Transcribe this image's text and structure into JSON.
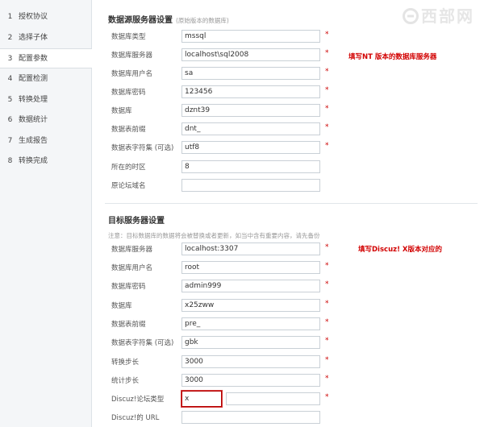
{
  "sidebar": {
    "steps": [
      {
        "num": "1",
        "label": "授权协议"
      },
      {
        "num": "2",
        "label": "选择子体"
      },
      {
        "num": "3",
        "label": "配置参数"
      },
      {
        "num": "4",
        "label": "配置检测"
      },
      {
        "num": "5",
        "label": "转换处理"
      },
      {
        "num": "6",
        "label": "数据统计"
      },
      {
        "num": "7",
        "label": "生成报告"
      },
      {
        "num": "8",
        "label": "转换完成"
      }
    ]
  },
  "logo": {
    "text": "西部网"
  },
  "source_section": {
    "title": "数据源服务器设置",
    "subtitle": "(原始版本的数据库)",
    "annotation": "填写NT 版本的数据库服务器",
    "fields": [
      {
        "label": "数据库类型",
        "value": "mssql",
        "required": "*"
      },
      {
        "label": "数据库服务器",
        "value": "localhost\\sql2008",
        "required": "*"
      },
      {
        "label": "数据库用户名",
        "value": "sa",
        "required": "*"
      },
      {
        "label": "数据库密码",
        "value": "123456",
        "required": "*"
      },
      {
        "label": "数据库",
        "value": "dznt39",
        "required": "*"
      },
      {
        "label": "数据表前缀",
        "value": "dnt_",
        "required": "*"
      },
      {
        "label": "数据表字符集 (可选)",
        "value": "utf8",
        "required": "*"
      },
      {
        "label": "所在的时区",
        "value": "8",
        "required": ""
      },
      {
        "label": "原论坛域名",
        "value": "",
        "required": ""
      }
    ]
  },
  "target_section": {
    "title": "目标服务器设置",
    "notice": "注意：目标数据库的数据将会被替换或者更新，如当中含有重要内容，请先备份",
    "annotation": "填写Discuz! X版本对应的",
    "fields": [
      {
        "label": "数据库服务器",
        "value": "localhost:3307",
        "required": "*"
      },
      {
        "label": "数据库用户名",
        "value": "root",
        "required": "*"
      },
      {
        "label": "数据库密码",
        "value": "admin999",
        "required": "*"
      },
      {
        "label": "数据库",
        "value": "x25zww",
        "required": "*"
      },
      {
        "label": "数据表前缀",
        "value": "pre_",
        "required": "*"
      },
      {
        "label": "数据表字符集 (可选)",
        "value": "gbk",
        "required": "*"
      },
      {
        "label": "转换步长",
        "value": "3000",
        "required": "*"
      },
      {
        "label": "统计步长",
        "value": "3000",
        "required": "*"
      },
      {
        "label": "Discuz!论坛类型",
        "value": "x",
        "required": "*"
      },
      {
        "label": "Discuz!的 URL",
        "value": "",
        "required": ""
      }
    ]
  },
  "colors": {
    "accent_red": "#d20000",
    "highlight_border": "#b40000"
  }
}
